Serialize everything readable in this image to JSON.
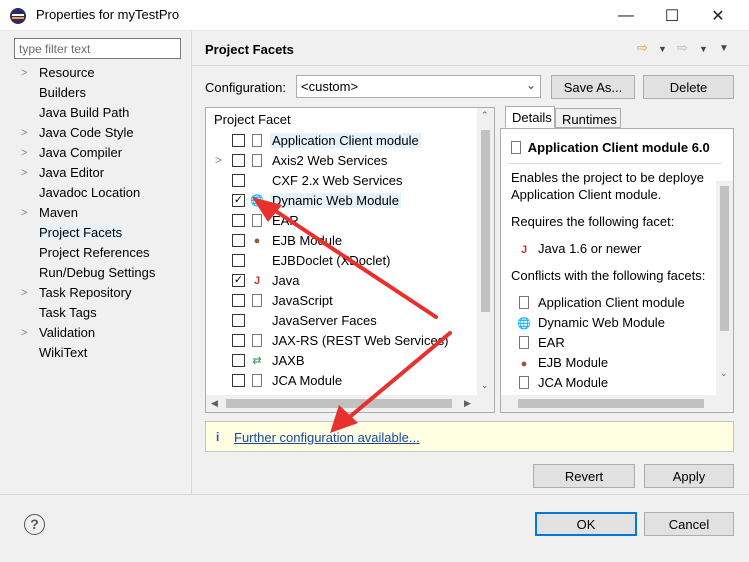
{
  "window": {
    "title": "Properties for myTestPro"
  },
  "filter": {
    "placeholder": "type filter text"
  },
  "nav": {
    "items": [
      {
        "label": "Resource",
        "expandable": true
      },
      {
        "label": "Builders",
        "expandable": false
      },
      {
        "label": "Java Build Path",
        "expandable": false
      },
      {
        "label": "Java Code Style",
        "expandable": true
      },
      {
        "label": "Java Compiler",
        "expandable": true
      },
      {
        "label": "Java Editor",
        "expandable": true
      },
      {
        "label": "Javadoc Location",
        "expandable": false
      },
      {
        "label": "Maven",
        "expandable": true
      },
      {
        "label": "Project Facets",
        "expandable": false,
        "selected": true
      },
      {
        "label": "Project References",
        "expandable": false
      },
      {
        "label": "Run/Debug Settings",
        "expandable": false
      },
      {
        "label": "Task Repository",
        "expandable": true
      },
      {
        "label": "Task Tags",
        "expandable": false
      },
      {
        "label": "Validation",
        "expandable": true
      },
      {
        "label": "WikiText",
        "expandable": false
      }
    ]
  },
  "page": {
    "title": "Project Facets"
  },
  "config": {
    "label": "Configuration:",
    "value": "<custom>",
    "save_as": "Save As...",
    "delete": "Delete"
  },
  "facets": {
    "header": "Project Facet",
    "rows": [
      {
        "label": "Application Client module",
        "checked": false,
        "icon": "document-icon",
        "highlight": true
      },
      {
        "label": "Axis2 Web Services",
        "checked": false,
        "icon": "document-icon",
        "expander": true
      },
      {
        "label": "CXF 2.x Web Services",
        "checked": false,
        "icon": "none"
      },
      {
        "label": "Dynamic Web Module",
        "checked": true,
        "icon": "web-module-icon",
        "highlight": true
      },
      {
        "label": "EAR",
        "checked": false,
        "icon": "document-icon"
      },
      {
        "label": "EJB Module",
        "checked": false,
        "icon": "bean-icon"
      },
      {
        "label": "EJBDoclet (XDoclet)",
        "checked": false,
        "icon": "none"
      },
      {
        "label": "Java",
        "checked": true,
        "icon": "java-icon"
      },
      {
        "label": "JavaScript",
        "checked": false,
        "icon": "document-icon"
      },
      {
        "label": "JavaServer Faces",
        "checked": false,
        "icon": "none"
      },
      {
        "label": "JAX-RS (REST Web Services)",
        "checked": false,
        "icon": "document-icon"
      },
      {
        "label": "JAXB",
        "checked": false,
        "icon": "jaxb-icon"
      },
      {
        "label": "JCA Module",
        "checked": false,
        "icon": "document-icon"
      }
    ]
  },
  "details": {
    "tabs": [
      "Details",
      "Runtimes"
    ],
    "heading": "Application Client module 6.0",
    "desc1": "Enables the project to be deploye",
    "desc2": "Application Client module.",
    "requires_label": "Requires the following facet:",
    "requires": [
      {
        "label": "Java 1.6 or newer",
        "icon": "java-icon"
      }
    ],
    "conflicts_label": "Conflicts with the following facets:",
    "conflicts": [
      {
        "label": "Application Client module",
        "icon": "document-icon"
      },
      {
        "label": "Dynamic Web Module",
        "icon": "web-module-icon"
      },
      {
        "label": "EAR",
        "icon": "document-icon"
      },
      {
        "label": "EJB Module",
        "icon": "bean-icon"
      },
      {
        "label": "JCA Module",
        "icon": "document-icon"
      }
    ]
  },
  "info": {
    "link": "Further configuration available..."
  },
  "buttons": {
    "revert": "Revert",
    "apply": "Apply",
    "ok": "OK",
    "cancel": "Cancel"
  },
  "colors": {
    "annotation_arrow": "#e8302c",
    "selection": "#e5f1fb",
    "link": "#1a47a6",
    "info_bg": "#ffffe1"
  }
}
